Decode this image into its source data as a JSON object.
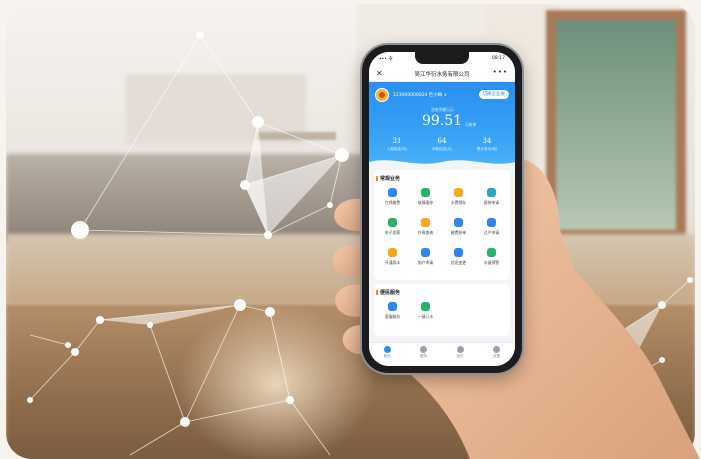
{
  "phone": {
    "status": {
      "carrier": "••• 令",
      "time": "08:17"
    },
    "nav": {
      "close": "✕",
      "title": "吴江华衍水务有限公司",
      "more": "•••"
    },
    "header": {
      "account": "123000000024  巨小梅 ∨",
      "switch_button": "切换企业账",
      "balance_label": "当前余额(元)",
      "balance_value": "99.51",
      "balance_unit": "元账单",
      "stats": [
        {
          "value": "31",
          "label": "上期用量(吨)"
        },
        {
          "value": "64",
          "label": "本期应缴(元)"
        },
        {
          "value": "34",
          "label": "累计用水(吨)"
        }
      ]
    },
    "common_services": {
      "title": "常规业务",
      "items": [
        {
          "label": "在线缴费",
          "icon": "search-icon",
          "color": "#2e86f0"
        },
        {
          "label": "故障报修",
          "icon": "wrench-icon",
          "color": "#27b36a"
        },
        {
          "label": "水费预存",
          "icon": "wallet-icon",
          "color": "#f5a623"
        },
        {
          "label": "报装申请",
          "icon": "flag-icon",
          "color": "#22a7c9"
        },
        {
          "label": "电子发票",
          "icon": "invoice-icon",
          "color": "#27b36a"
        },
        {
          "label": "抄表查询",
          "icon": "sun-icon",
          "color": "#f5a623"
        },
        {
          "label": "缴费账单",
          "icon": "monitor-icon",
          "color": "#2e86f0"
        },
        {
          "label": "过户申请",
          "icon": "person-icon",
          "color": "#2e86f0"
        },
        {
          "label": "开通用水",
          "icon": "check-icon",
          "color": "#f5a623"
        },
        {
          "label": "销户申请",
          "icon": "user-group-icon",
          "color": "#2e86f0"
        },
        {
          "label": "信息变更",
          "icon": "document-icon",
          "color": "#2e86f0"
        },
        {
          "label": "水量预警",
          "icon": "drop-icon",
          "color": "#27b36a"
        }
      ]
    },
    "convenience_services": {
      "title": "便民服务",
      "items": [
        {
          "label": "客服服务",
          "icon": "flask-icon",
          "color": "#2e86f0"
        },
        {
          "label": "一键订水",
          "icon": "send-icon",
          "color": "#27b36a"
        }
      ]
    },
    "tabbar": [
      {
        "label": "首页",
        "icon": "home-icon",
        "active": true
      },
      {
        "label": "服务",
        "icon": "service-icon",
        "active": false
      },
      {
        "label": "我的",
        "icon": "user-icon",
        "active": false
      },
      {
        "label": "设置",
        "icon": "settings-icon",
        "active": false
      }
    ]
  }
}
